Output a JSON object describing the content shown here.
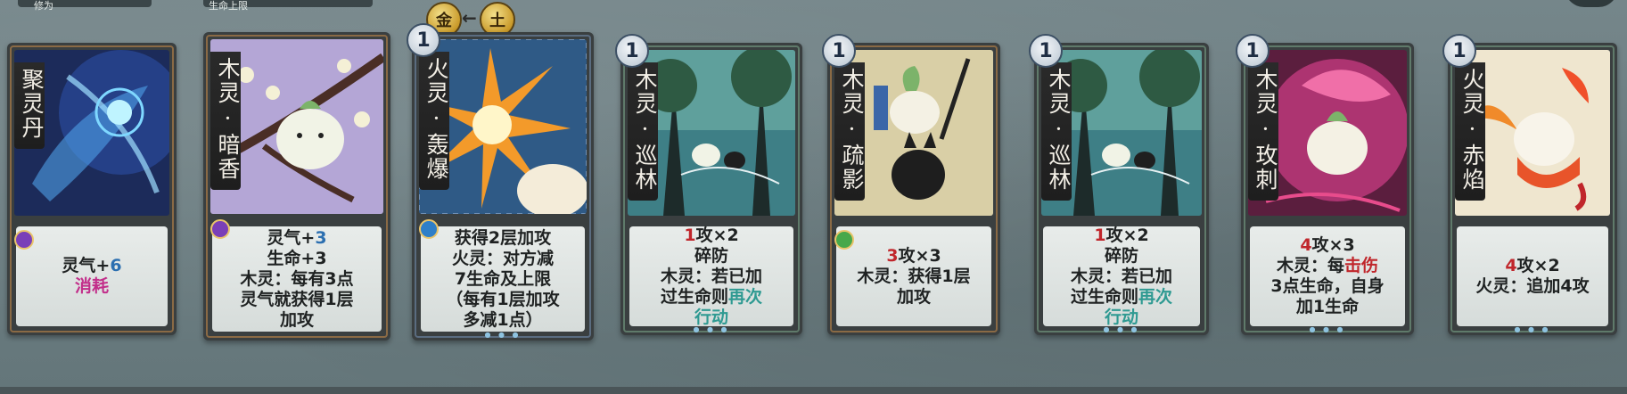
{
  "top": {
    "label_left": "修为",
    "label_mid": "生命上限",
    "element_from": "金",
    "element_to": "土"
  },
  "cards": [
    {
      "id": "c1",
      "name": "聚灵丹",
      "cost": "",
      "gem": "purple",
      "lines": [
        [
          {
            "t": "灵气+"
          },
          {
            "t": "6",
            "c": "blue"
          }
        ],
        [
          {
            "t": "消耗",
            "c": "pink"
          }
        ]
      ]
    },
    {
      "id": "c2",
      "name": "木灵·暗香",
      "cost": "",
      "gem": "purple",
      "lines": [
        [
          {
            "t": "灵气+"
          },
          {
            "t": "3",
            "c": "blue"
          }
        ],
        [
          {
            "t": "生命+3"
          }
        ],
        [
          {
            "t": "木灵：每有3点"
          }
        ],
        [
          {
            "t": "灵气就获得1层"
          }
        ],
        [
          {
            "t": "加攻"
          }
        ]
      ]
    },
    {
      "id": "c3",
      "name": "火灵·轰爆",
      "cost": "1",
      "gem": "blue",
      "lines": [
        [
          {
            "t": "获得2层加攻"
          }
        ],
        [
          {
            "t": "火灵：对方减"
          }
        ],
        [
          {
            "t": "7生命及上限"
          }
        ],
        [
          {
            "t": "（每有1层加攻"
          }
        ],
        [
          {
            "t": "多减1点）"
          }
        ]
      ]
    },
    {
      "id": "c4",
      "name": "木灵·巡林",
      "cost": "1",
      "gem": "",
      "lines": [
        [
          {
            "t": "1",
            "c": "red"
          },
          {
            "t": "攻×2"
          }
        ],
        [
          {
            "t": "碎防"
          }
        ],
        [
          {
            "t": "木灵：若已加"
          }
        ],
        [
          {
            "t": "过生命则"
          },
          {
            "t": "再次",
            "c": "teal"
          }
        ],
        [
          {
            "t": "行动",
            "c": "teal"
          }
        ]
      ]
    },
    {
      "id": "c5",
      "name": "木灵·疏影",
      "cost": "1",
      "gem": "green",
      "lines": [
        [
          {
            "t": "3",
            "c": "red"
          },
          {
            "t": "攻×3"
          }
        ],
        [
          {
            "t": "木灵：获得1层"
          }
        ],
        [
          {
            "t": "加攻"
          }
        ]
      ]
    },
    {
      "id": "c6",
      "name": "木灵·巡林",
      "cost": "1",
      "gem": "",
      "lines": [
        [
          {
            "t": "1",
            "c": "red"
          },
          {
            "t": "攻×2"
          }
        ],
        [
          {
            "t": "碎防"
          }
        ],
        [
          {
            "t": "木灵：若已加"
          }
        ],
        [
          {
            "t": "过生命则"
          },
          {
            "t": "再次",
            "c": "teal"
          }
        ],
        [
          {
            "t": "行动",
            "c": "teal"
          }
        ]
      ]
    },
    {
      "id": "c7",
      "name": "木灵·玫刺",
      "cost": "1",
      "gem": "",
      "lines": [
        [
          {
            "t": "4",
            "c": "red"
          },
          {
            "t": "攻×3"
          }
        ],
        [
          {
            "t": "木灵：每"
          },
          {
            "t": "击伤",
            "c": "red"
          }
        ],
        [
          {
            "t": "3点生命，自身"
          }
        ],
        [
          {
            "t": "加1生命"
          }
        ]
      ]
    },
    {
      "id": "c8",
      "name": "火灵·赤焰",
      "cost": "1",
      "gem": "",
      "lines": [
        [
          {
            "t": "4",
            "c": "red"
          },
          {
            "t": "攻×2"
          }
        ],
        [
          {
            "t": "火灵：追加4攻"
          }
        ]
      ]
    }
  ]
}
